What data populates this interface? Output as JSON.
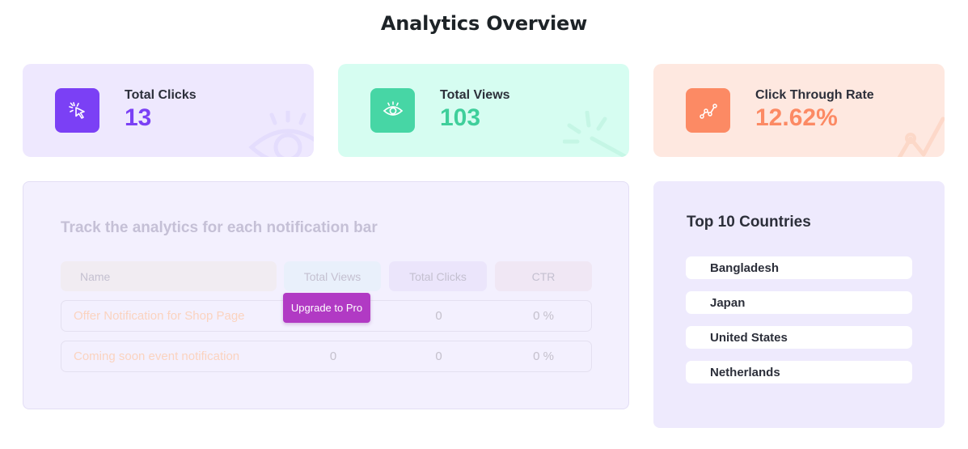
{
  "page": {
    "title": "Analytics Overview"
  },
  "stats": {
    "clicks": {
      "label": "Total Clicks",
      "value": "13",
      "icon": "cursor-click-icon",
      "color": "#7b40f5"
    },
    "views": {
      "label": "Total Views",
      "value": "103",
      "icon": "eye-icon",
      "color": "#47d6a5"
    },
    "ctr": {
      "label": "Click Through Rate",
      "value": "12.62%",
      "icon": "trend-line-icon",
      "color": "#fc8a64"
    }
  },
  "notifications": {
    "heading": "Track the analytics for each notification bar",
    "columns": [
      "Name",
      "Total Views",
      "Total Clicks",
      "CTR"
    ],
    "rows": [
      {
        "name": "Offer Notification for Shop Page",
        "views": "",
        "clicks": "0",
        "ctr": "0 %"
      },
      {
        "name": "Coming soon event notification",
        "views": "0",
        "clicks": "0",
        "ctr": "0 %"
      }
    ],
    "upgrade_label": "Upgrade to Pro"
  },
  "countries": {
    "title": "Top 10 Countries",
    "items": [
      "Bangladesh",
      "Japan",
      "United States",
      "Netherlands"
    ]
  }
}
